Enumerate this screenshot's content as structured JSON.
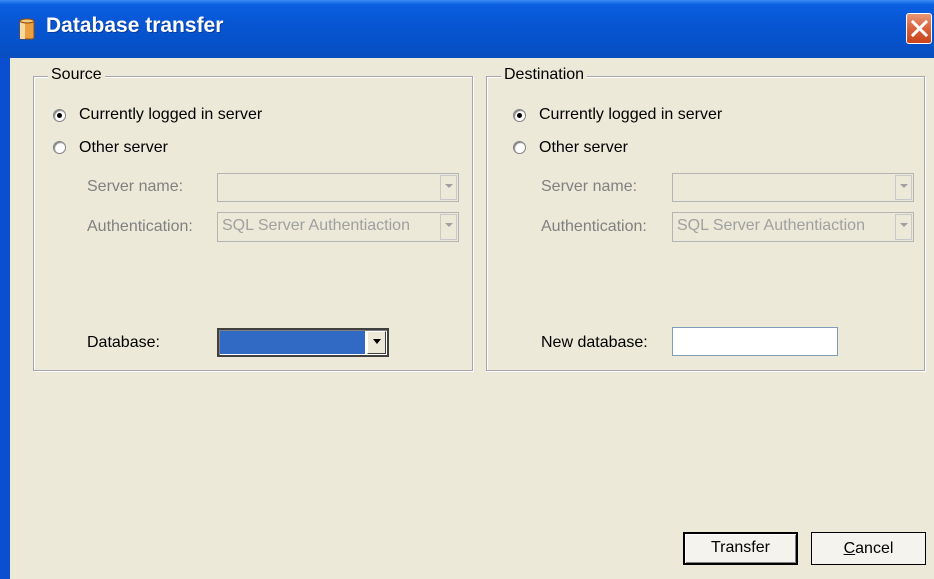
{
  "window": {
    "title": "Database transfer",
    "titlebar_color": "#0a5fe0",
    "icon": "database-icon",
    "close_icon": "close-icon"
  },
  "source": {
    "group_title": "Source",
    "radio_current": "Currently logged in server",
    "radio_other": "Other server",
    "selected": "current",
    "server_name_label": "Server name:",
    "server_name_value": "",
    "authentication_label": "Authentication:",
    "authentication_value": "SQL Server Authentiaction",
    "database_label": "Database:",
    "database_value": ""
  },
  "destination": {
    "group_title": "Destination",
    "radio_current": "Currently logged in server",
    "radio_other": "Other server",
    "selected": "current",
    "server_name_label": "Server name:",
    "server_name_value": "",
    "authentication_label": "Authentication:",
    "authentication_value": "SQL Server Authentiaction",
    "new_database_label": "New database:",
    "new_database_value": ""
  },
  "buttons": {
    "transfer_label": "Transfer",
    "cancel_label_pre": "",
    "cancel_accel": "C",
    "cancel_label_post": "ancel"
  }
}
